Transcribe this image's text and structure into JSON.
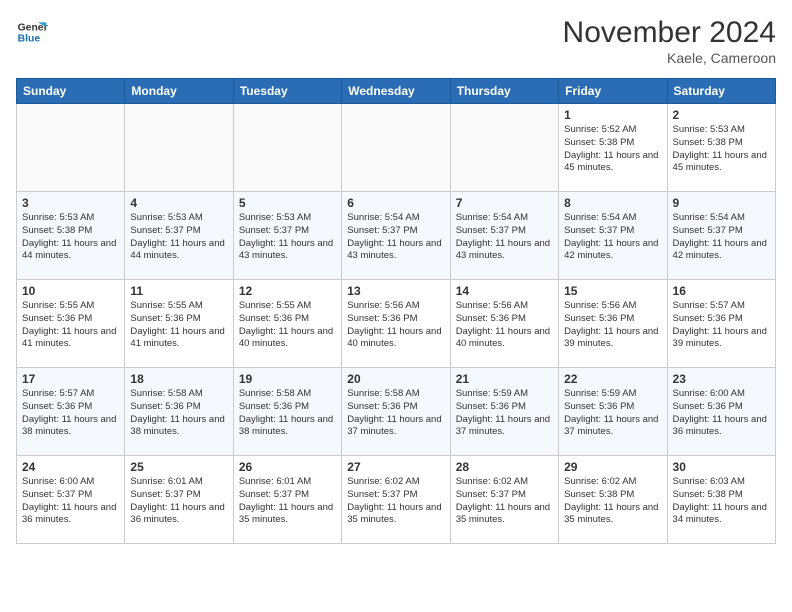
{
  "header": {
    "logo_line1": "General",
    "logo_line2": "Blue",
    "month_year": "November 2024",
    "location": "Kaele, Cameroon"
  },
  "weekdays": [
    "Sunday",
    "Monday",
    "Tuesday",
    "Wednesday",
    "Thursday",
    "Friday",
    "Saturday"
  ],
  "weeks": [
    [
      {
        "day": "",
        "info": ""
      },
      {
        "day": "",
        "info": ""
      },
      {
        "day": "",
        "info": ""
      },
      {
        "day": "",
        "info": ""
      },
      {
        "day": "",
        "info": ""
      },
      {
        "day": "1",
        "info": "Sunrise: 5:52 AM\nSunset: 5:38 PM\nDaylight: 11 hours and 45 minutes."
      },
      {
        "day": "2",
        "info": "Sunrise: 5:53 AM\nSunset: 5:38 PM\nDaylight: 11 hours and 45 minutes."
      }
    ],
    [
      {
        "day": "3",
        "info": "Sunrise: 5:53 AM\nSunset: 5:38 PM\nDaylight: 11 hours and 44 minutes."
      },
      {
        "day": "4",
        "info": "Sunrise: 5:53 AM\nSunset: 5:37 PM\nDaylight: 11 hours and 44 minutes."
      },
      {
        "day": "5",
        "info": "Sunrise: 5:53 AM\nSunset: 5:37 PM\nDaylight: 11 hours and 43 minutes."
      },
      {
        "day": "6",
        "info": "Sunrise: 5:54 AM\nSunset: 5:37 PM\nDaylight: 11 hours and 43 minutes."
      },
      {
        "day": "7",
        "info": "Sunrise: 5:54 AM\nSunset: 5:37 PM\nDaylight: 11 hours and 43 minutes."
      },
      {
        "day": "8",
        "info": "Sunrise: 5:54 AM\nSunset: 5:37 PM\nDaylight: 11 hours and 42 minutes."
      },
      {
        "day": "9",
        "info": "Sunrise: 5:54 AM\nSunset: 5:37 PM\nDaylight: 11 hours and 42 minutes."
      }
    ],
    [
      {
        "day": "10",
        "info": "Sunrise: 5:55 AM\nSunset: 5:36 PM\nDaylight: 11 hours and 41 minutes."
      },
      {
        "day": "11",
        "info": "Sunrise: 5:55 AM\nSunset: 5:36 PM\nDaylight: 11 hours and 41 minutes."
      },
      {
        "day": "12",
        "info": "Sunrise: 5:55 AM\nSunset: 5:36 PM\nDaylight: 11 hours and 40 minutes."
      },
      {
        "day": "13",
        "info": "Sunrise: 5:56 AM\nSunset: 5:36 PM\nDaylight: 11 hours and 40 minutes."
      },
      {
        "day": "14",
        "info": "Sunrise: 5:56 AM\nSunset: 5:36 PM\nDaylight: 11 hours and 40 minutes."
      },
      {
        "day": "15",
        "info": "Sunrise: 5:56 AM\nSunset: 5:36 PM\nDaylight: 11 hours and 39 minutes."
      },
      {
        "day": "16",
        "info": "Sunrise: 5:57 AM\nSunset: 5:36 PM\nDaylight: 11 hours and 39 minutes."
      }
    ],
    [
      {
        "day": "17",
        "info": "Sunrise: 5:57 AM\nSunset: 5:36 PM\nDaylight: 11 hours and 38 minutes."
      },
      {
        "day": "18",
        "info": "Sunrise: 5:58 AM\nSunset: 5:36 PM\nDaylight: 11 hours and 38 minutes."
      },
      {
        "day": "19",
        "info": "Sunrise: 5:58 AM\nSunset: 5:36 PM\nDaylight: 11 hours and 38 minutes."
      },
      {
        "day": "20",
        "info": "Sunrise: 5:58 AM\nSunset: 5:36 PM\nDaylight: 11 hours and 37 minutes."
      },
      {
        "day": "21",
        "info": "Sunrise: 5:59 AM\nSunset: 5:36 PM\nDaylight: 11 hours and 37 minutes."
      },
      {
        "day": "22",
        "info": "Sunrise: 5:59 AM\nSunset: 5:36 PM\nDaylight: 11 hours and 37 minutes."
      },
      {
        "day": "23",
        "info": "Sunrise: 6:00 AM\nSunset: 5:36 PM\nDaylight: 11 hours and 36 minutes."
      }
    ],
    [
      {
        "day": "24",
        "info": "Sunrise: 6:00 AM\nSunset: 5:37 PM\nDaylight: 11 hours and 36 minutes."
      },
      {
        "day": "25",
        "info": "Sunrise: 6:01 AM\nSunset: 5:37 PM\nDaylight: 11 hours and 36 minutes."
      },
      {
        "day": "26",
        "info": "Sunrise: 6:01 AM\nSunset: 5:37 PM\nDaylight: 11 hours and 35 minutes."
      },
      {
        "day": "27",
        "info": "Sunrise: 6:02 AM\nSunset: 5:37 PM\nDaylight: 11 hours and 35 minutes."
      },
      {
        "day": "28",
        "info": "Sunrise: 6:02 AM\nSunset: 5:37 PM\nDaylight: 11 hours and 35 minutes."
      },
      {
        "day": "29",
        "info": "Sunrise: 6:02 AM\nSunset: 5:38 PM\nDaylight: 11 hours and 35 minutes."
      },
      {
        "day": "30",
        "info": "Sunrise: 6:03 AM\nSunset: 5:38 PM\nDaylight: 11 hours and 34 minutes."
      }
    ]
  ]
}
